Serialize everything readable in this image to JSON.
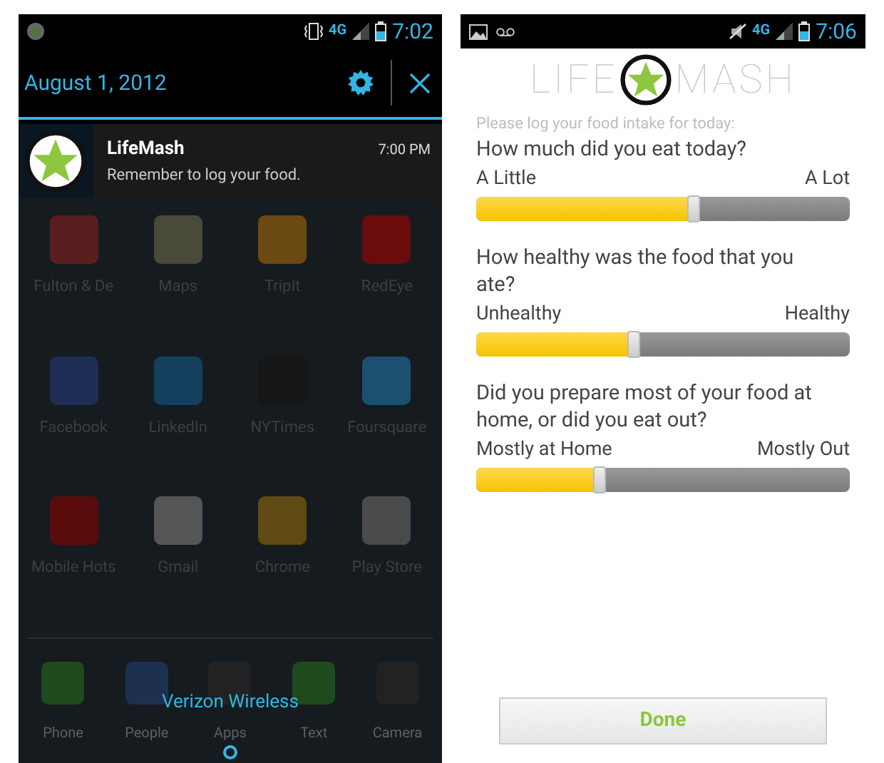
{
  "notification_shade": {
    "status_bar": {
      "time": "7:02",
      "network": "4G"
    },
    "header": {
      "date": "August 1, 2012"
    },
    "notification": {
      "title": "LifeMash",
      "time": "7:00 PM",
      "text": "Remember to log your food."
    },
    "home_screen": {
      "apps": [
        {
          "label": "Fulton & De",
          "color": "#5a1e1e"
        },
        {
          "label": "Maps",
          "color": "#4a4a3a"
        },
        {
          "label": "TripIt",
          "color": "#6a4a12"
        },
        {
          "label": "RedEye",
          "color": "#6a0c0c"
        },
        {
          "label": "Facebook",
          "color": "#1e2e55"
        },
        {
          "label": "LinkedIn",
          "color": "#14405e"
        },
        {
          "label": "NYTimes",
          "color": "#161616"
        },
        {
          "label": "Foursquare",
          "color": "#1c5070"
        },
        {
          "label": "Mobile Hots",
          "color": "#5a0c0c"
        },
        {
          "label": "Gmail",
          "color": "#555555"
        },
        {
          "label": "Chrome",
          "color": "#5e4a12"
        },
        {
          "label": "Play Store",
          "color": "#4a4a4a"
        }
      ],
      "carrier": "Verizon Wireless",
      "dock": [
        {
          "label": "Phone",
          "color": "#1e4a1e"
        },
        {
          "label": "People",
          "color": "#1e3050"
        },
        {
          "label": "Apps",
          "color": "#222222"
        },
        {
          "label": "Text",
          "color": "#1e4a1e"
        },
        {
          "label": "Camera",
          "color": "#222222"
        }
      ]
    }
  },
  "lifemash_app": {
    "status_bar": {
      "time": "7:06",
      "network": "4G"
    },
    "logo": {
      "left": "LIFE",
      "right": "MASH"
    },
    "prompt": "Please log your food intake for today:",
    "sliders": [
      {
        "question": "How much did you eat today?",
        "min_label": "A Little",
        "max_label": "A Lot",
        "level": 0.58
      },
      {
        "question": "How healthy was the food that you ate?",
        "min_label": "Unhealthy",
        "max_label": "Healthy",
        "level": 0.42
      },
      {
        "question": "Did you prepare most of your food at home, or did you eat out?",
        "min_label": "Mostly at Home",
        "max_label": "Mostly Out",
        "level": 0.33
      }
    ],
    "done_button": "Done"
  }
}
